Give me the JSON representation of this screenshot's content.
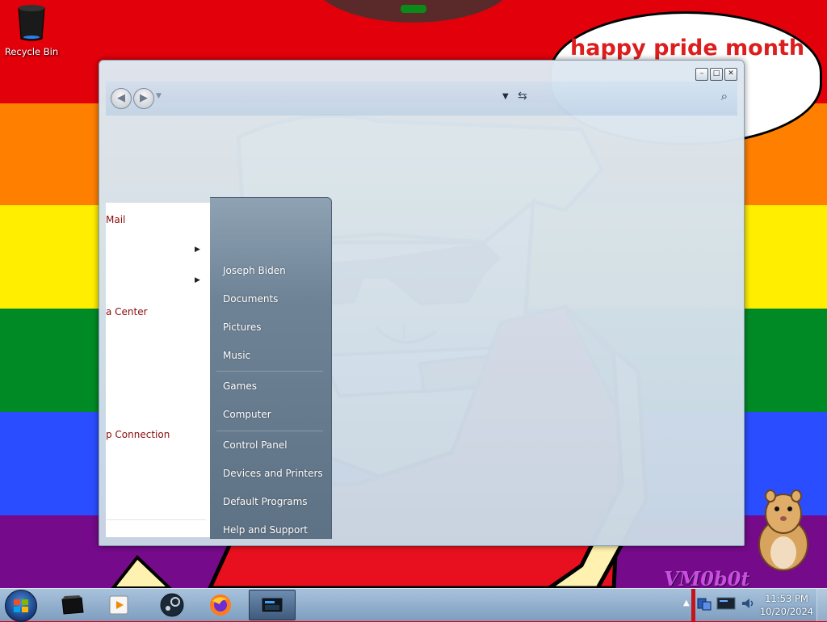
{
  "desktop": {
    "icons": [
      {
        "label": "Recycle Bin",
        "icon": "recycle-bin-icon"
      }
    ],
    "wallpaper": {
      "bubble_text": "happy pride month",
      "watermark": "VM0b0t"
    }
  },
  "explorer": {
    "controls": {
      "minimize": "–",
      "maximize": "□",
      "close": "✕"
    }
  },
  "start_menu": {
    "left_items": [
      {
        "label": "Mail",
        "has_arrow": false
      },
      {
        "label": "",
        "has_arrow": true
      },
      {
        "label": "",
        "has_arrow": true
      },
      {
        "label": "a Center",
        "has_arrow": false
      },
      {
        "label": "p Connection",
        "has_arrow": false
      }
    ],
    "right_items": [
      {
        "label": "Joseph Biden"
      },
      {
        "label": "Documents"
      },
      {
        "label": "Pictures"
      },
      {
        "label": "Music"
      },
      {
        "label": "Games"
      },
      {
        "label": "Computer"
      },
      {
        "label": "Control Panel"
      },
      {
        "label": "Devices and Printers"
      },
      {
        "label": "Default Programs"
      },
      {
        "label": "Help and Support"
      }
    ]
  },
  "taskbar": {
    "pinned": [
      {
        "name": "recycle-bin-app",
        "icon": "recycle-bin-icon"
      },
      {
        "name": "media-player",
        "icon": "media-player-icon"
      },
      {
        "name": "steam",
        "icon": "steam-icon"
      },
      {
        "name": "firefox",
        "icon": "firefox-icon"
      },
      {
        "name": "explorer-window",
        "icon": "window-icon",
        "active": true
      }
    ],
    "clock": {
      "time": "11:53 PM",
      "date": "10/20/2024"
    }
  },
  "colors": {
    "menu_link": "#8a0a0a",
    "bubble_text": "#dc1e1e",
    "watermark": "#c94fe0"
  }
}
